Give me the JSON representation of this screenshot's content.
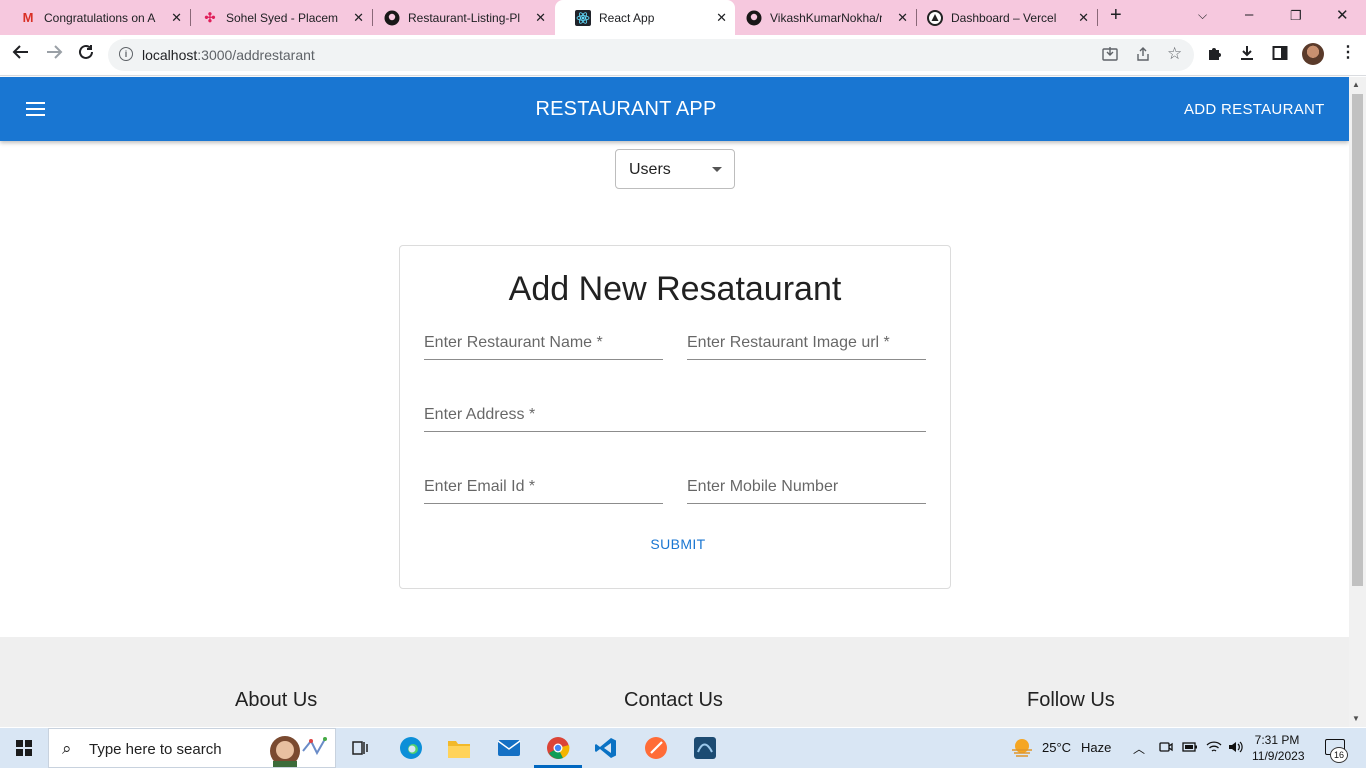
{
  "browser": {
    "tabs": [
      {
        "title": "Congratulations on A",
        "icon": "gmail-icon"
      },
      {
        "title": "Sohel Syed - Placeme",
        "icon": "slack-icon"
      },
      {
        "title": "Restaurant-Listing-Pl",
        "icon": "github-icon"
      },
      {
        "title": "React App",
        "icon": "react-icon",
        "active": true
      },
      {
        "title": "VikashKumarNokha/r",
        "icon": "github-icon"
      },
      {
        "title": "Dashboard – Vercel",
        "icon": "vercel-icon"
      }
    ],
    "url_host": "localhost",
    "url_path": ":3000/addrestarant"
  },
  "appbar": {
    "title": "RESTAURANT APP",
    "add_button": "ADD RESTAURANT",
    "color": "#1976d2"
  },
  "users_select": {
    "value": "Users"
  },
  "form": {
    "title": "Add New Resataurant",
    "fields": {
      "name": "Enter Restaurant Name *",
      "image_url": "Enter Restaurant Image url *",
      "address": "Enter Address *",
      "email": "Enter Email Id *",
      "mobile": "Enter Mobile Number"
    },
    "submit": "SUBMIT"
  },
  "footer": {
    "about": "About Us",
    "contact": "Contact Us",
    "follow": "Follow Us"
  },
  "taskbar": {
    "search_placeholder": "Type here to search",
    "weather_temp": "25°C",
    "weather_desc": "Haze",
    "time": "7:31 PM",
    "date": "11/9/2023",
    "notification_count": "16"
  }
}
